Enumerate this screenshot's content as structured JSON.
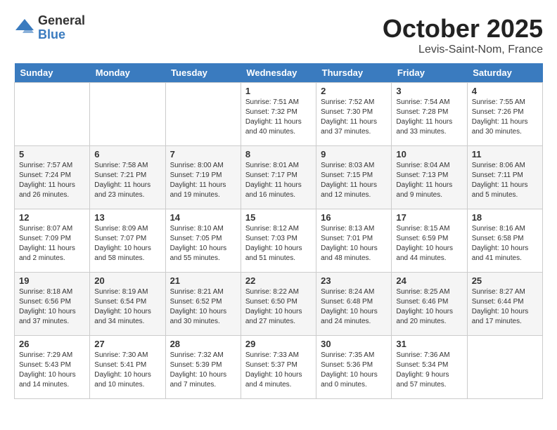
{
  "header": {
    "logo_general": "General",
    "logo_blue": "Blue",
    "month_title": "October 2025",
    "location": "Levis-Saint-Nom, France"
  },
  "days_of_week": [
    "Sunday",
    "Monday",
    "Tuesday",
    "Wednesday",
    "Thursday",
    "Friday",
    "Saturday"
  ],
  "weeks": [
    [
      {
        "day": "",
        "info": ""
      },
      {
        "day": "",
        "info": ""
      },
      {
        "day": "",
        "info": ""
      },
      {
        "day": "1",
        "info": "Sunrise: 7:51 AM\nSunset: 7:32 PM\nDaylight: 11 hours and 40 minutes."
      },
      {
        "day": "2",
        "info": "Sunrise: 7:52 AM\nSunset: 7:30 PM\nDaylight: 11 hours and 37 minutes."
      },
      {
        "day": "3",
        "info": "Sunrise: 7:54 AM\nSunset: 7:28 PM\nDaylight: 11 hours and 33 minutes."
      },
      {
        "day": "4",
        "info": "Sunrise: 7:55 AM\nSunset: 7:26 PM\nDaylight: 11 hours and 30 minutes."
      }
    ],
    [
      {
        "day": "5",
        "info": "Sunrise: 7:57 AM\nSunset: 7:24 PM\nDaylight: 11 hours and 26 minutes."
      },
      {
        "day": "6",
        "info": "Sunrise: 7:58 AM\nSunset: 7:21 PM\nDaylight: 11 hours and 23 minutes."
      },
      {
        "day": "7",
        "info": "Sunrise: 8:00 AM\nSunset: 7:19 PM\nDaylight: 11 hours and 19 minutes."
      },
      {
        "day": "8",
        "info": "Sunrise: 8:01 AM\nSunset: 7:17 PM\nDaylight: 11 hours and 16 minutes."
      },
      {
        "day": "9",
        "info": "Sunrise: 8:03 AM\nSunset: 7:15 PM\nDaylight: 11 hours and 12 minutes."
      },
      {
        "day": "10",
        "info": "Sunrise: 8:04 AM\nSunset: 7:13 PM\nDaylight: 11 hours and 9 minutes."
      },
      {
        "day": "11",
        "info": "Sunrise: 8:06 AM\nSunset: 7:11 PM\nDaylight: 11 hours and 5 minutes."
      }
    ],
    [
      {
        "day": "12",
        "info": "Sunrise: 8:07 AM\nSunset: 7:09 PM\nDaylight: 11 hours and 2 minutes."
      },
      {
        "day": "13",
        "info": "Sunrise: 8:09 AM\nSunset: 7:07 PM\nDaylight: 10 hours and 58 minutes."
      },
      {
        "day": "14",
        "info": "Sunrise: 8:10 AM\nSunset: 7:05 PM\nDaylight: 10 hours and 55 minutes."
      },
      {
        "day": "15",
        "info": "Sunrise: 8:12 AM\nSunset: 7:03 PM\nDaylight: 10 hours and 51 minutes."
      },
      {
        "day": "16",
        "info": "Sunrise: 8:13 AM\nSunset: 7:01 PM\nDaylight: 10 hours and 48 minutes."
      },
      {
        "day": "17",
        "info": "Sunrise: 8:15 AM\nSunset: 6:59 PM\nDaylight: 10 hours and 44 minutes."
      },
      {
        "day": "18",
        "info": "Sunrise: 8:16 AM\nSunset: 6:58 PM\nDaylight: 10 hours and 41 minutes."
      }
    ],
    [
      {
        "day": "19",
        "info": "Sunrise: 8:18 AM\nSunset: 6:56 PM\nDaylight: 10 hours and 37 minutes."
      },
      {
        "day": "20",
        "info": "Sunrise: 8:19 AM\nSunset: 6:54 PM\nDaylight: 10 hours and 34 minutes."
      },
      {
        "day": "21",
        "info": "Sunrise: 8:21 AM\nSunset: 6:52 PM\nDaylight: 10 hours and 30 minutes."
      },
      {
        "day": "22",
        "info": "Sunrise: 8:22 AM\nSunset: 6:50 PM\nDaylight: 10 hours and 27 minutes."
      },
      {
        "day": "23",
        "info": "Sunrise: 8:24 AM\nSunset: 6:48 PM\nDaylight: 10 hours and 24 minutes."
      },
      {
        "day": "24",
        "info": "Sunrise: 8:25 AM\nSunset: 6:46 PM\nDaylight: 10 hours and 20 minutes."
      },
      {
        "day": "25",
        "info": "Sunrise: 8:27 AM\nSunset: 6:44 PM\nDaylight: 10 hours and 17 minutes."
      }
    ],
    [
      {
        "day": "26",
        "info": "Sunrise: 7:29 AM\nSunset: 5:43 PM\nDaylight: 10 hours and 14 minutes."
      },
      {
        "day": "27",
        "info": "Sunrise: 7:30 AM\nSunset: 5:41 PM\nDaylight: 10 hours and 10 minutes."
      },
      {
        "day": "28",
        "info": "Sunrise: 7:32 AM\nSunset: 5:39 PM\nDaylight: 10 hours and 7 minutes."
      },
      {
        "day": "29",
        "info": "Sunrise: 7:33 AM\nSunset: 5:37 PM\nDaylight: 10 hours and 4 minutes."
      },
      {
        "day": "30",
        "info": "Sunrise: 7:35 AM\nSunset: 5:36 PM\nDaylight: 10 hours and 0 minutes."
      },
      {
        "day": "31",
        "info": "Sunrise: 7:36 AM\nSunset: 5:34 PM\nDaylight: 9 hours and 57 minutes."
      },
      {
        "day": "",
        "info": ""
      }
    ]
  ]
}
